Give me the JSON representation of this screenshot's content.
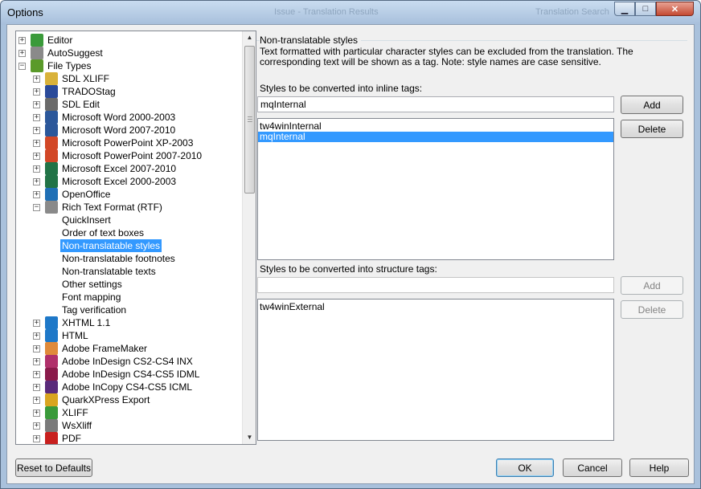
{
  "window": {
    "title": "Options",
    "ghost_title_1": "Issue - Translation Results",
    "ghost_title_2": "Translation Search",
    "controls": {
      "minimize": "▁",
      "maximize": "□",
      "close": "✕"
    }
  },
  "tree": {
    "items": [
      {
        "label": "Editor",
        "icon": "pencil-icon",
        "color": "#3a9a3a",
        "exp": "+"
      },
      {
        "label": "AutoSuggest",
        "icon": "autosuggest-icon",
        "color": "#8a8a8a",
        "exp": "+"
      },
      {
        "label": "File Types",
        "icon": "file-types-icon",
        "color": "#5a9a2a",
        "exp": "−"
      },
      {
        "label": "SDL XLIFF",
        "icon": "sdl-xliff-icon",
        "color": "#d9b23a",
        "exp": "+"
      },
      {
        "label": "TRADOStag",
        "icon": "tradostag-icon",
        "color": "#2a4a9a",
        "exp": "+"
      },
      {
        "label": "SDL Edit",
        "icon": "sdl-edit-icon",
        "color": "#6a6a6a",
        "exp": "+"
      },
      {
        "label": "Microsoft Word 2000-2003",
        "icon": "word-icon",
        "color": "#2b579a",
        "exp": "+"
      },
      {
        "label": "Microsoft Word 2007-2010",
        "icon": "word-icon",
        "color": "#2b579a",
        "exp": "+"
      },
      {
        "label": "Microsoft PowerPoint XP-2003",
        "icon": "powerpoint-icon",
        "color": "#d24726",
        "exp": "+"
      },
      {
        "label": "Microsoft PowerPoint 2007-2010",
        "icon": "powerpoint-icon",
        "color": "#d24726",
        "exp": "+"
      },
      {
        "label": "Microsoft Excel 2007-2010",
        "icon": "excel-icon",
        "color": "#217346",
        "exp": "+"
      },
      {
        "label": "Microsoft Excel 2000-2003",
        "icon": "excel-icon",
        "color": "#217346",
        "exp": "+"
      },
      {
        "label": "OpenOffice",
        "icon": "openoffice-icon",
        "color": "#1f6fb5",
        "exp": "+"
      },
      {
        "label": "Rich Text Format (RTF)",
        "icon": "rtf-icon",
        "color": "#8a8a8a",
        "exp": "−"
      },
      {
        "label": "QuickInsert",
        "child": true
      },
      {
        "label": "Order of text boxes",
        "child": true
      },
      {
        "label": "Non-translatable styles",
        "child": true,
        "selected": true
      },
      {
        "label": "Non-translatable footnotes",
        "child": true
      },
      {
        "label": "Non-translatable texts",
        "child": true
      },
      {
        "label": "Other settings",
        "child": true
      },
      {
        "label": "Font mapping",
        "child": true
      },
      {
        "label": "Tag verification",
        "child": true
      },
      {
        "label": "XHTML 1.1",
        "icon": "ie-icon",
        "color": "#1e78c8",
        "exp": "+"
      },
      {
        "label": "HTML",
        "icon": "ie-icon",
        "color": "#1e78c8",
        "exp": "+"
      },
      {
        "label": "Adobe FrameMaker",
        "icon": "framemaker-icon",
        "color": "#e08a3a",
        "exp": "+"
      },
      {
        "label": "Adobe InDesign CS2-CS4 INX",
        "icon": "indesign-icon",
        "color": "#b0306a",
        "exp": "+"
      },
      {
        "label": "Adobe InDesign CS4-CS5 IDML",
        "icon": "indesign-icon",
        "color": "#8a1a4a",
        "exp": "+"
      },
      {
        "label": "Adobe InCopy CS4-CS5 ICML",
        "icon": "incopy-icon",
        "color": "#5a2a7a",
        "exp": "+"
      },
      {
        "label": "QuarkXPress Export",
        "icon": "quark-icon",
        "color": "#d9a520",
        "exp": "+"
      },
      {
        "label": "XLIFF",
        "icon": "xliff-icon",
        "color": "#3a9a3a",
        "exp": "+"
      },
      {
        "label": "WsXliff",
        "icon": "wsxliff-icon",
        "color": "#7a7a7a",
        "exp": "+"
      },
      {
        "label": "PDF",
        "icon": "pdf-icon",
        "color": "#c8201e",
        "exp": "+"
      }
    ]
  },
  "panel": {
    "group_title": "Non-translatable styles",
    "description": "Text formatted with particular character styles can be excluded from the translation. The corresponding text will be shown as a tag. Note: style names are case sensitive.",
    "inline_label": "Styles to be converted into inline tags:",
    "inline_input": "mqInternal",
    "inline_list": [
      "tw4winInternal",
      "mqInternal"
    ],
    "inline_selected": 1,
    "add": "Add",
    "delete": "Delete",
    "structure_label": "Styles to be converted into structure tags:",
    "structure_input": "",
    "structure_list": [
      "tw4winExternal"
    ],
    "add2": "Add",
    "delete2": "Delete"
  },
  "footer": {
    "reset": "Reset to Defaults",
    "ok": "OK",
    "cancel": "Cancel",
    "help": "Help"
  }
}
